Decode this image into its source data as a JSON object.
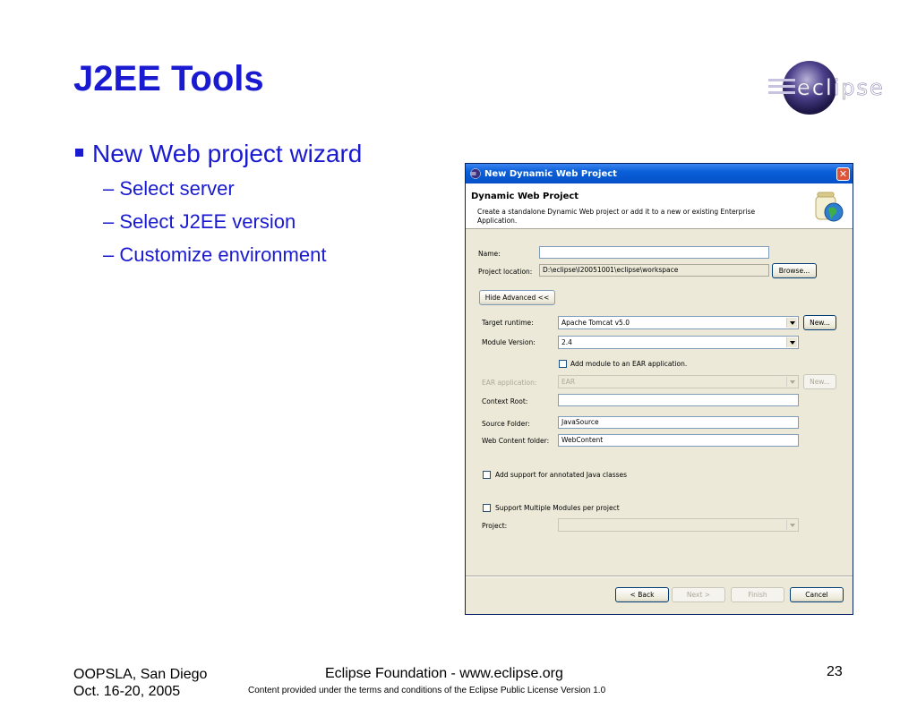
{
  "slide": {
    "title": "J2EE Tools",
    "bullet_main": "New Web project wizard",
    "sub_bullets": [
      "– Select server",
      "– Select J2EE version",
      "– Customize environment"
    ],
    "logo_text": "eclipse"
  },
  "dialog": {
    "window_title": "New Dynamic Web Project",
    "banner_title": "Dynamic Web Project",
    "banner_desc": "Create a standalone Dynamic Web project or add it to a new or existing Enterprise Application.",
    "name_label": "Name:",
    "name_value": "",
    "location_label": "Project location:",
    "location_value": "D:\\eclipse\\I20051001\\eclipse\\workspace",
    "browse_label": "Browse...",
    "hide_advanced_label": "Hide Advanced <<",
    "target_runtime_label": "Target runtime:",
    "target_runtime_value": "Apache Tomcat v5.0",
    "new_label": "New...",
    "module_version_label": "Module Version:",
    "module_version_value": "2.4",
    "add_ear_label": "Add module to an EAR application.",
    "ear_app_label": "EAR application:",
    "ear_app_value": "EAR",
    "new2_label": "New...",
    "context_root_label": "Context Root:",
    "context_root_value": "",
    "source_folder_label": "Source Folder:",
    "source_folder_value": "JavaSource",
    "web_content_label": "Web Content folder:",
    "web_content_value": "WebContent",
    "annotated_label": "Add support for annotated Java classes",
    "multi_modules_label": "Support Multiple Modules per project",
    "project_label": "Project:",
    "back_label": "< Back",
    "next_label": "Next >",
    "finish_label": "Finish",
    "cancel_label": "Cancel",
    "close_glyph": "✕"
  },
  "footer": {
    "event": "OOPSLA, San Diego",
    "date": "Oct. 16-20, 2005",
    "foundation": "Eclipse Foundation - www.eclipse.org",
    "license": "Content provided under the terms and conditions of the Eclipse Public License Version 1.0",
    "page_number": "23"
  },
  "colors": {
    "title_blue": "#1a1ad1",
    "xp_titlebar": "#0a5fd8",
    "dialog_bg": "#ece9d8"
  }
}
